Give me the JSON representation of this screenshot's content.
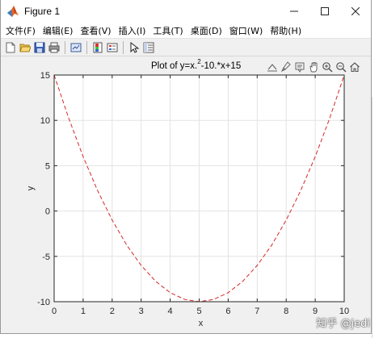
{
  "window": {
    "title": "Figure 1",
    "controls": {
      "minimize": "—",
      "maximize": "☐",
      "close": "✕"
    }
  },
  "menu": {
    "items": [
      "文件(F)",
      "编辑(E)",
      "查看(V)",
      "插入(I)",
      "工具(T)",
      "桌面(D)",
      "窗口(W)",
      "帮助(H)"
    ]
  },
  "toolbar": {
    "buttons": [
      "new-figure-icon",
      "open-file-icon",
      "save-icon",
      "print-icon",
      "link-plot-icon",
      "insert-colorbar-icon",
      "insert-legend-icon",
      "edit-plot-icon",
      "property-inspector-icon"
    ]
  },
  "axes_toolbar": {
    "buttons": [
      "export-icon",
      "brush-icon",
      "data-tips-icon",
      "pan-icon",
      "zoom-in-icon",
      "zoom-out-icon",
      "home-icon"
    ]
  },
  "plot": {
    "title_main": "Plot of y=x.",
    "title_sup": "2",
    "title_rest": "-10.*x+15"
  },
  "watermark": "知乎 @jedi",
  "chart_data": {
    "type": "line",
    "title": "Plot of y=x.^2-10.*x+15",
    "xlabel": "x",
    "ylabel": "y",
    "xlim": [
      0,
      10
    ],
    "ylim": [
      -10,
      15
    ],
    "xticks": [
      0,
      1,
      2,
      3,
      4,
      5,
      6,
      7,
      8,
      9,
      10
    ],
    "yticks": [
      -10,
      -5,
      0,
      5,
      10,
      15
    ],
    "grid": true,
    "series": [
      {
        "line_style": "dashed",
        "color": "#d62728",
        "x": [
          0,
          0.5,
          1,
          1.5,
          2,
          2.5,
          3,
          3.5,
          4,
          4.5,
          5,
          5.5,
          6,
          6.5,
          7,
          7.5,
          8,
          8.5,
          9,
          9.5,
          10
        ],
        "y": [
          15,
          10.25,
          6,
          2.25,
          -1,
          -3.75,
          -6,
          -7.75,
          -9,
          -9.75,
          -10,
          -9.75,
          -9,
          -7.75,
          -6,
          -3.75,
          -1,
          2.25,
          6,
          10.25,
          15
        ]
      }
    ]
  }
}
